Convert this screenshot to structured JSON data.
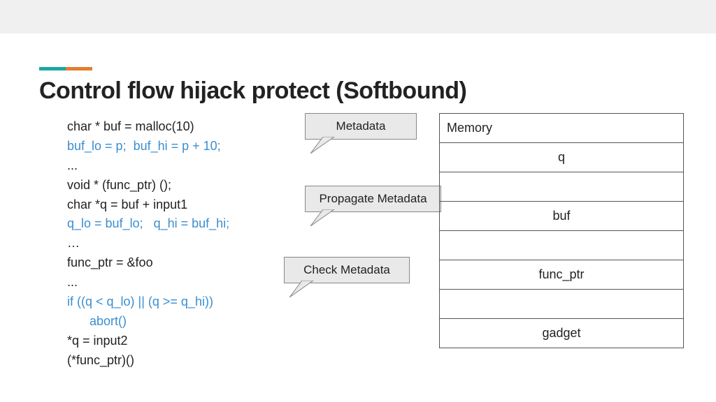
{
  "title": "Control flow hijack protect (Softbound)",
  "code": {
    "l1": "char * buf = malloc(10)",
    "l2": "buf_lo = p;  buf_hi = p + 10;",
    "l3": "...",
    "l4": "void * (func_ptr) ();",
    "l5": "char *q = buf + input1",
    "l6": "q_lo = buf_lo;   q_hi = buf_hi;",
    "l7": "…",
    "l8": "func_ptr = &foo",
    "l9": "...",
    "l10": "if ((q < q_lo) || (q >= q_hi))",
    "l11": "abort()",
    "l12": "*q = input2",
    "l13": "(*func_ptr)()"
  },
  "callouts": {
    "c1": "Metadata",
    "c2": "Propagate Metadata",
    "c3": "Check Metadata"
  },
  "memory": {
    "header": "Memory",
    "rows": [
      "q",
      "",
      "buf",
      "",
      "func_ptr",
      "",
      "gadget"
    ]
  }
}
